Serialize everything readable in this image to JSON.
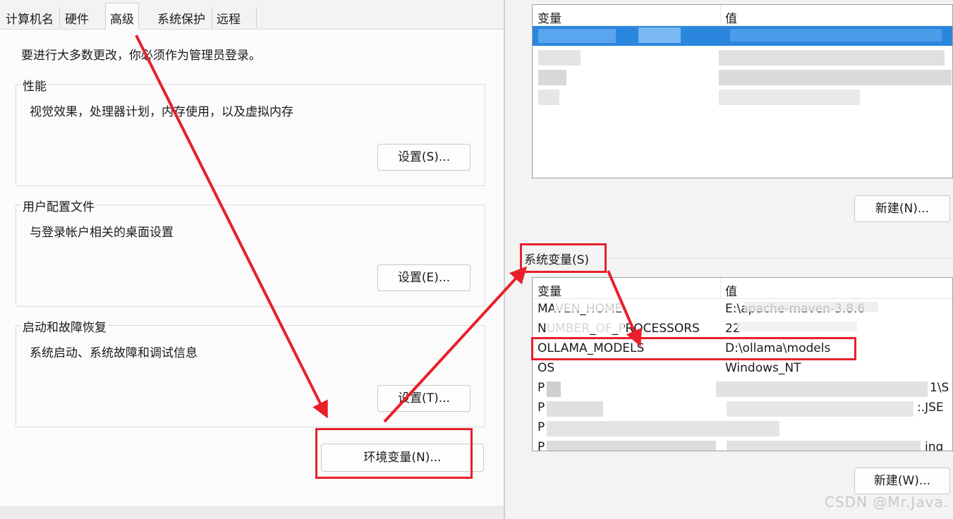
{
  "left_dialog": {
    "tabs": [
      {
        "label": "计算机名"
      },
      {
        "label": "硬件"
      },
      {
        "label": "高级"
      },
      {
        "label": "系统保护"
      },
      {
        "label": "远程"
      }
    ],
    "admin_note": "要进行大多数更改，你必须作为管理员登录。",
    "groups": [
      {
        "title": "性能",
        "description": "视觉效果，处理器计划，内存使用，以及虚拟内存",
        "button": "设置(S)..."
      },
      {
        "title": "用户配置文件",
        "description": "与登录帐户相关的桌面设置",
        "button": "设置(E)..."
      },
      {
        "title": "启动和故障恢复",
        "description": "系统启动、系统故障和调试信息",
        "button": "设置(T)..."
      }
    ],
    "env_button": "环境变量(N)..."
  },
  "right_dialog": {
    "user_vars": {
      "col_variable": "变量",
      "col_value": "值",
      "new_button": "新建(N)..."
    },
    "system_vars": {
      "group_label": "系统变量(S)",
      "col_variable": "变量",
      "col_value": "值",
      "rows": [
        {
          "variable": "MAVEN_HOME",
          "value": "E:\\apache-maven-3.8.6"
        },
        {
          "variable": "NUMBER_OF_PROCESSORS",
          "value": "22"
        },
        {
          "variable": "OLLAMA_MODELS",
          "value": "D:\\ollama\\models"
        },
        {
          "variable": "OS",
          "value": "Windows_NT"
        },
        {
          "variable": "P",
          "value": "1\\S"
        },
        {
          "variable": "P",
          "value": ":.JSE"
        },
        {
          "variable": "P",
          "value": ""
        },
        {
          "variable": "P",
          "value": "ing"
        }
      ],
      "new_button": "新建(W)..."
    }
  },
  "watermark": "CSDN @Mr.Java.",
  "colors": {
    "annotation": "#e8202a",
    "selection": "#1e7fd8"
  }
}
